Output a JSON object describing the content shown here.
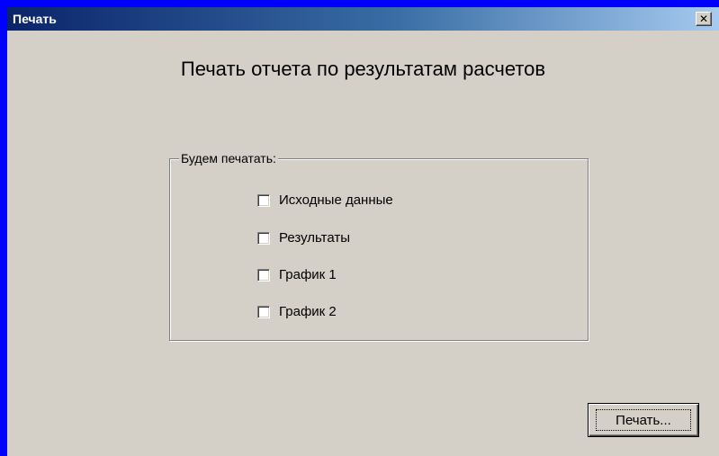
{
  "window": {
    "title": "Печать",
    "close_glyph": "✕",
    "close_icon": "close-icon"
  },
  "heading": "Печать отчета по результатам расчетов",
  "group": {
    "legend": "Будем печатать:",
    "options": [
      {
        "label": "Исходные данные",
        "checked": false
      },
      {
        "label": "Результаты",
        "checked": false
      },
      {
        "label": "График 1",
        "checked": false
      },
      {
        "label": "График 2",
        "checked": false
      }
    ]
  },
  "actions": {
    "print_label": "Печать..."
  },
  "colors": {
    "desktop": "#0000ff",
    "face": "#d4d0c8",
    "title_start": "#0a246a",
    "title_end": "#a6caf0"
  }
}
